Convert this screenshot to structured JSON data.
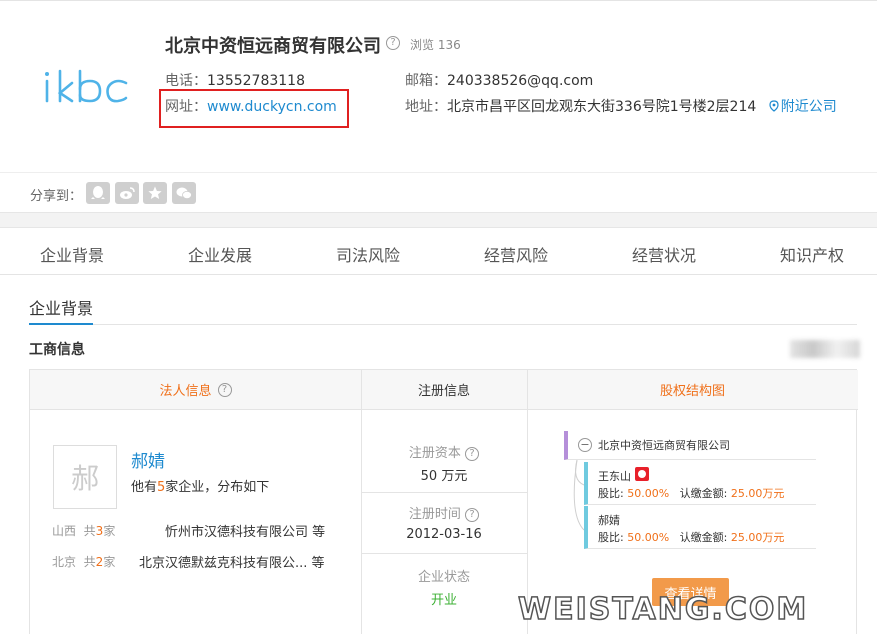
{
  "header": {
    "logo_text": "ikbc",
    "company_name": "北京中资恒远商贸有限公司",
    "views_label": "浏览",
    "views_count": "136",
    "phone_label": "电话：",
    "phone": "13552783118",
    "email_label": "邮箱：",
    "email": "240338526@qq.com",
    "website_label": "网址：",
    "website": "www.duckycn.com",
    "address_label": "地址：",
    "address": "北京市昌平区回龙观东大街336号院1号楼2层214",
    "nearby_label": "附近公司"
  },
  "share": {
    "label": "分享到：",
    "buttons": [
      "qq-icon",
      "weibo-icon",
      "star-icon",
      "wechat-icon"
    ]
  },
  "tabs": [
    "企业背景",
    "企业发展",
    "司法风险",
    "经营风险",
    "经营状况",
    "知识产权"
  ],
  "section": {
    "title": "企业背景",
    "subtitle": "工商信息"
  },
  "legal_person": {
    "header": "法人信息",
    "avatar_char": "郝",
    "name": "郝婧",
    "desc_prefix": "他有",
    "desc_count": "5",
    "desc_suffix": "家企业，分布如下",
    "enterprises": [
      {
        "region": "山西",
        "total_prefix": "共",
        "count": "3",
        "unit": "家",
        "name": "忻州市汉德科技有限公司 等"
      },
      {
        "region": "北京",
        "total_prefix": "共",
        "count": "2",
        "unit": "家",
        "name": "北京汉德默兹克科技有限公... 等"
      }
    ]
  },
  "registration": {
    "header": "注册信息",
    "capital_label": "注册资本",
    "capital": "50 万元",
    "date_label": "注册时间",
    "date": "2012-03-16",
    "status_label": "企业状态",
    "status": "开业"
  },
  "equity": {
    "header": "股权结构图",
    "root": "北京中资恒远商贸有限公司",
    "holders": [
      {
        "name": "王东山",
        "ratio_label": "股比:",
        "ratio": "50.00%",
        "amount_label": "认缴金额:",
        "amount": "25.00万元"
      },
      {
        "name": "郝婧",
        "ratio_label": "股比:",
        "ratio": "50.00%",
        "amount_label": "认缴金额:",
        "amount": "25.00万元"
      }
    ],
    "detail_button": "查看详情"
  },
  "watermark": "WEISTANG.COM",
  "colors": {
    "accent_blue": "#1e8acf",
    "orange": "#f0701a",
    "green_status": "#3cb034",
    "highlight_red": "#e02020",
    "button_orange": "#f29a4a"
  }
}
